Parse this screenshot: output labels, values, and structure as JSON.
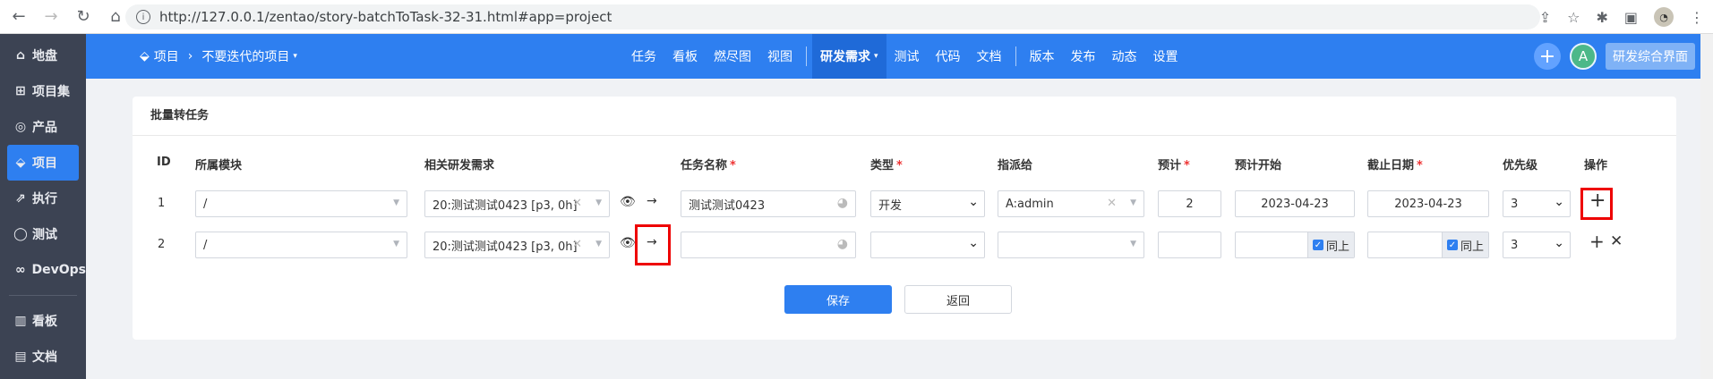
{
  "browser": {
    "url": "http://127.0.0.1/zentao/story-batchToTask-32-31.html#app=project"
  },
  "sidebar": {
    "items": [
      {
        "label": "地盘",
        "icon": "home-icon"
      },
      {
        "label": "项目集",
        "icon": "grid-icon"
      },
      {
        "label": "产品",
        "icon": "lightbulb-icon"
      },
      {
        "label": "项目",
        "icon": "project-icon"
      },
      {
        "label": "执行",
        "icon": "run-icon"
      },
      {
        "label": "测试",
        "icon": "search-icon"
      },
      {
        "label": "DevOps",
        "icon": "infinity-icon"
      },
      {
        "label": "看板",
        "icon": "kanban-icon"
      },
      {
        "label": "文档",
        "icon": "doc-icon"
      }
    ]
  },
  "header": {
    "breadcrumb_root": "项目",
    "breadcrumb_current": "不要迭代的项目",
    "nav": [
      "任务",
      "看板",
      "燃尽图",
      "视图",
      "研发需求",
      "测试",
      "代码",
      "文档",
      "版本",
      "发布",
      "动态",
      "设置"
    ],
    "user_initial": "A",
    "dev_button": "研发综合界面"
  },
  "panel": {
    "title": "批量转任务",
    "columns": {
      "id": "ID",
      "module": "所属模块",
      "story": "相关研发需求",
      "name": "任务名称",
      "type": "类型",
      "assign": "指派给",
      "estimate": "预计",
      "est_start": "预计开始",
      "deadline": "截止日期",
      "pri": "优先级",
      "actions": "操作"
    },
    "rows": [
      {
        "id": "1",
        "module": "/",
        "story": "20:测试测试0423 [p3, 0h]",
        "name": "测试测试0423",
        "type": "开发",
        "assign": "A:admin",
        "estimate": "2",
        "est_start": "2023-04-23",
        "deadline": "2023-04-23",
        "pri": "3"
      },
      {
        "id": "2",
        "module": "/",
        "story": "20:测试测试0423 [p3, 0h]",
        "name": "",
        "type": "",
        "assign": "",
        "estimate": "",
        "est_start": "",
        "deadline": "",
        "pri": "3",
        "same_label": "同上"
      }
    ],
    "save_label": "保存",
    "back_label": "返回"
  }
}
